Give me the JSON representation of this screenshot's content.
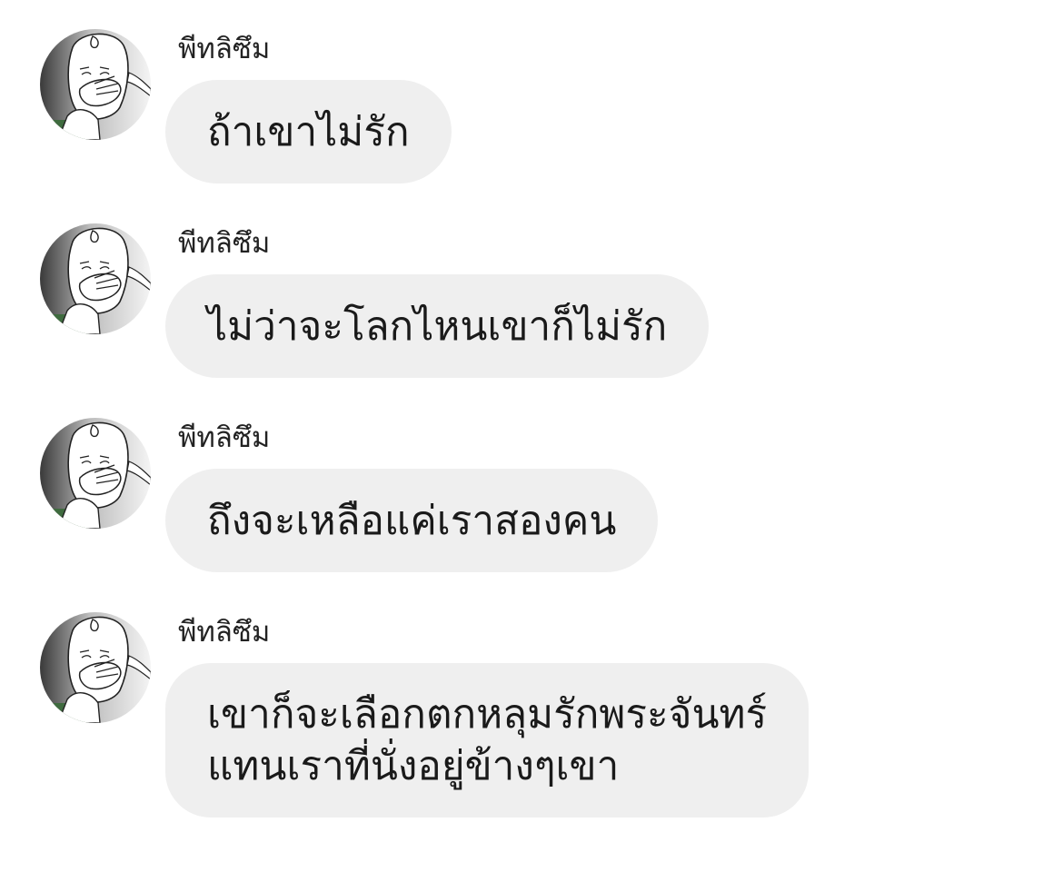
{
  "chat": {
    "messages": [
      {
        "sender": "พีทลิซึม",
        "lines": [
          "ถ้าเขาไม่รัก"
        ]
      },
      {
        "sender": "พีทลิซึม",
        "lines": [
          "ไม่ว่าจะโลกไหนเขาก็ไม่รัก"
        ]
      },
      {
        "sender": "พีทลิซึม",
        "lines": [
          "ถึงจะเหลือแค่เราสองคน"
        ]
      },
      {
        "sender": "พีทลิซึม",
        "lines": [
          "เขาก็จะเลือกตกหลุมรักพระจันทร์",
          "แทนเราที่นั่งอยู่ข้างๆเขา"
        ]
      }
    ]
  },
  "colors": {
    "bubble_background": "#efefef",
    "text": "#1a1a1a",
    "background": "#ffffff"
  },
  "icons": {
    "avatar": "meme-face-covering-mouth-avatar"
  }
}
